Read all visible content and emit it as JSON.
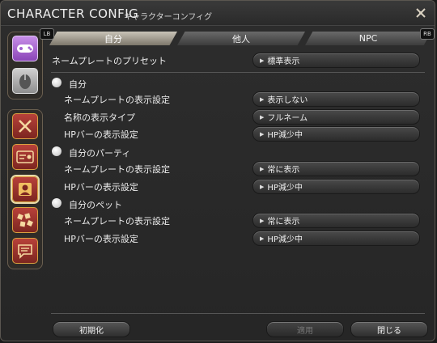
{
  "window": {
    "title": "CHARACTER CONFIG",
    "subtitle": "キャラクターコンフィグ",
    "close_icon": "close-icon"
  },
  "tabs": [
    {
      "label": "自分",
      "active": true
    },
    {
      "label": "他人",
      "active": false
    },
    {
      "label": "NPC",
      "active": false
    }
  ],
  "tab_badges": {
    "left": "LB",
    "right": "RB"
  },
  "preset": {
    "label": "ネームプレートのプリセット",
    "value": "標準表示"
  },
  "sections": {
    "self": {
      "title": "自分",
      "nameplate": {
        "label": "ネームプレートの表示設定",
        "value": "表示しない"
      },
      "name_type": {
        "label": "名称の表示タイプ",
        "value": "フルネーム"
      },
      "hp_bar": {
        "label": "HPバーの表示設定",
        "value": "HP減少中"
      }
    },
    "party": {
      "title": "自分のパーティ",
      "nameplate": {
        "label": "ネームプレートの表示設定",
        "value": "常に表示"
      },
      "hp_bar": {
        "label": "HPバーの表示設定",
        "value": "HP減少中"
      }
    },
    "pet": {
      "title": "自分のペット",
      "nameplate": {
        "label": "ネームプレートの表示設定",
        "value": "常に表示"
      },
      "hp_bar": {
        "label": "HPバーの表示設定",
        "value": "HP減少中"
      }
    }
  },
  "buttons": {
    "reset": "初期化",
    "apply": "適用",
    "close": "閉じる"
  },
  "colors": {
    "accent_red": "#b8413a",
    "accent_purple": "#a060d0",
    "tab_active": "#c9c4b8"
  }
}
